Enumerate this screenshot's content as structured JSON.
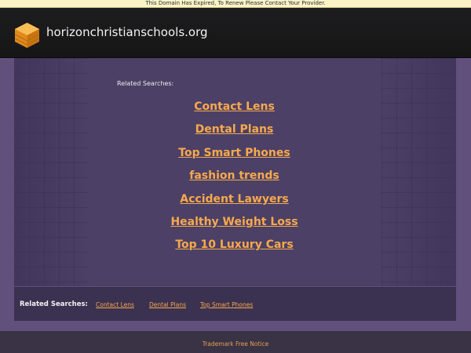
{
  "notice": {
    "text": "This Domain Has Expired, To Renew Please Contact Your Provider."
  },
  "header": {
    "logo_icon": "orange-stack-cube-icon",
    "site_name": "horizonchristianschools.org"
  },
  "main": {
    "related_label": "Related Searches:",
    "links": [
      "Contact Lens",
      "Dental Plans",
      "Top Smart Phones",
      "fashion trends",
      "Accident Lawyers",
      "Healthy Weight Loss",
      "Top 10 Luxury Cars"
    ]
  },
  "footer": {
    "label": "Related Searches:",
    "links": [
      "Contact Lens",
      "Dental Plans",
      "Top Smart Phones"
    ]
  },
  "bottom": {
    "trademark_text": "Trademark Free Notice"
  },
  "colors": {
    "link": "#f7a94c",
    "panel": "#4c4066",
    "header": "#1d1d1f",
    "notice_background": "#fbf3c6"
  }
}
